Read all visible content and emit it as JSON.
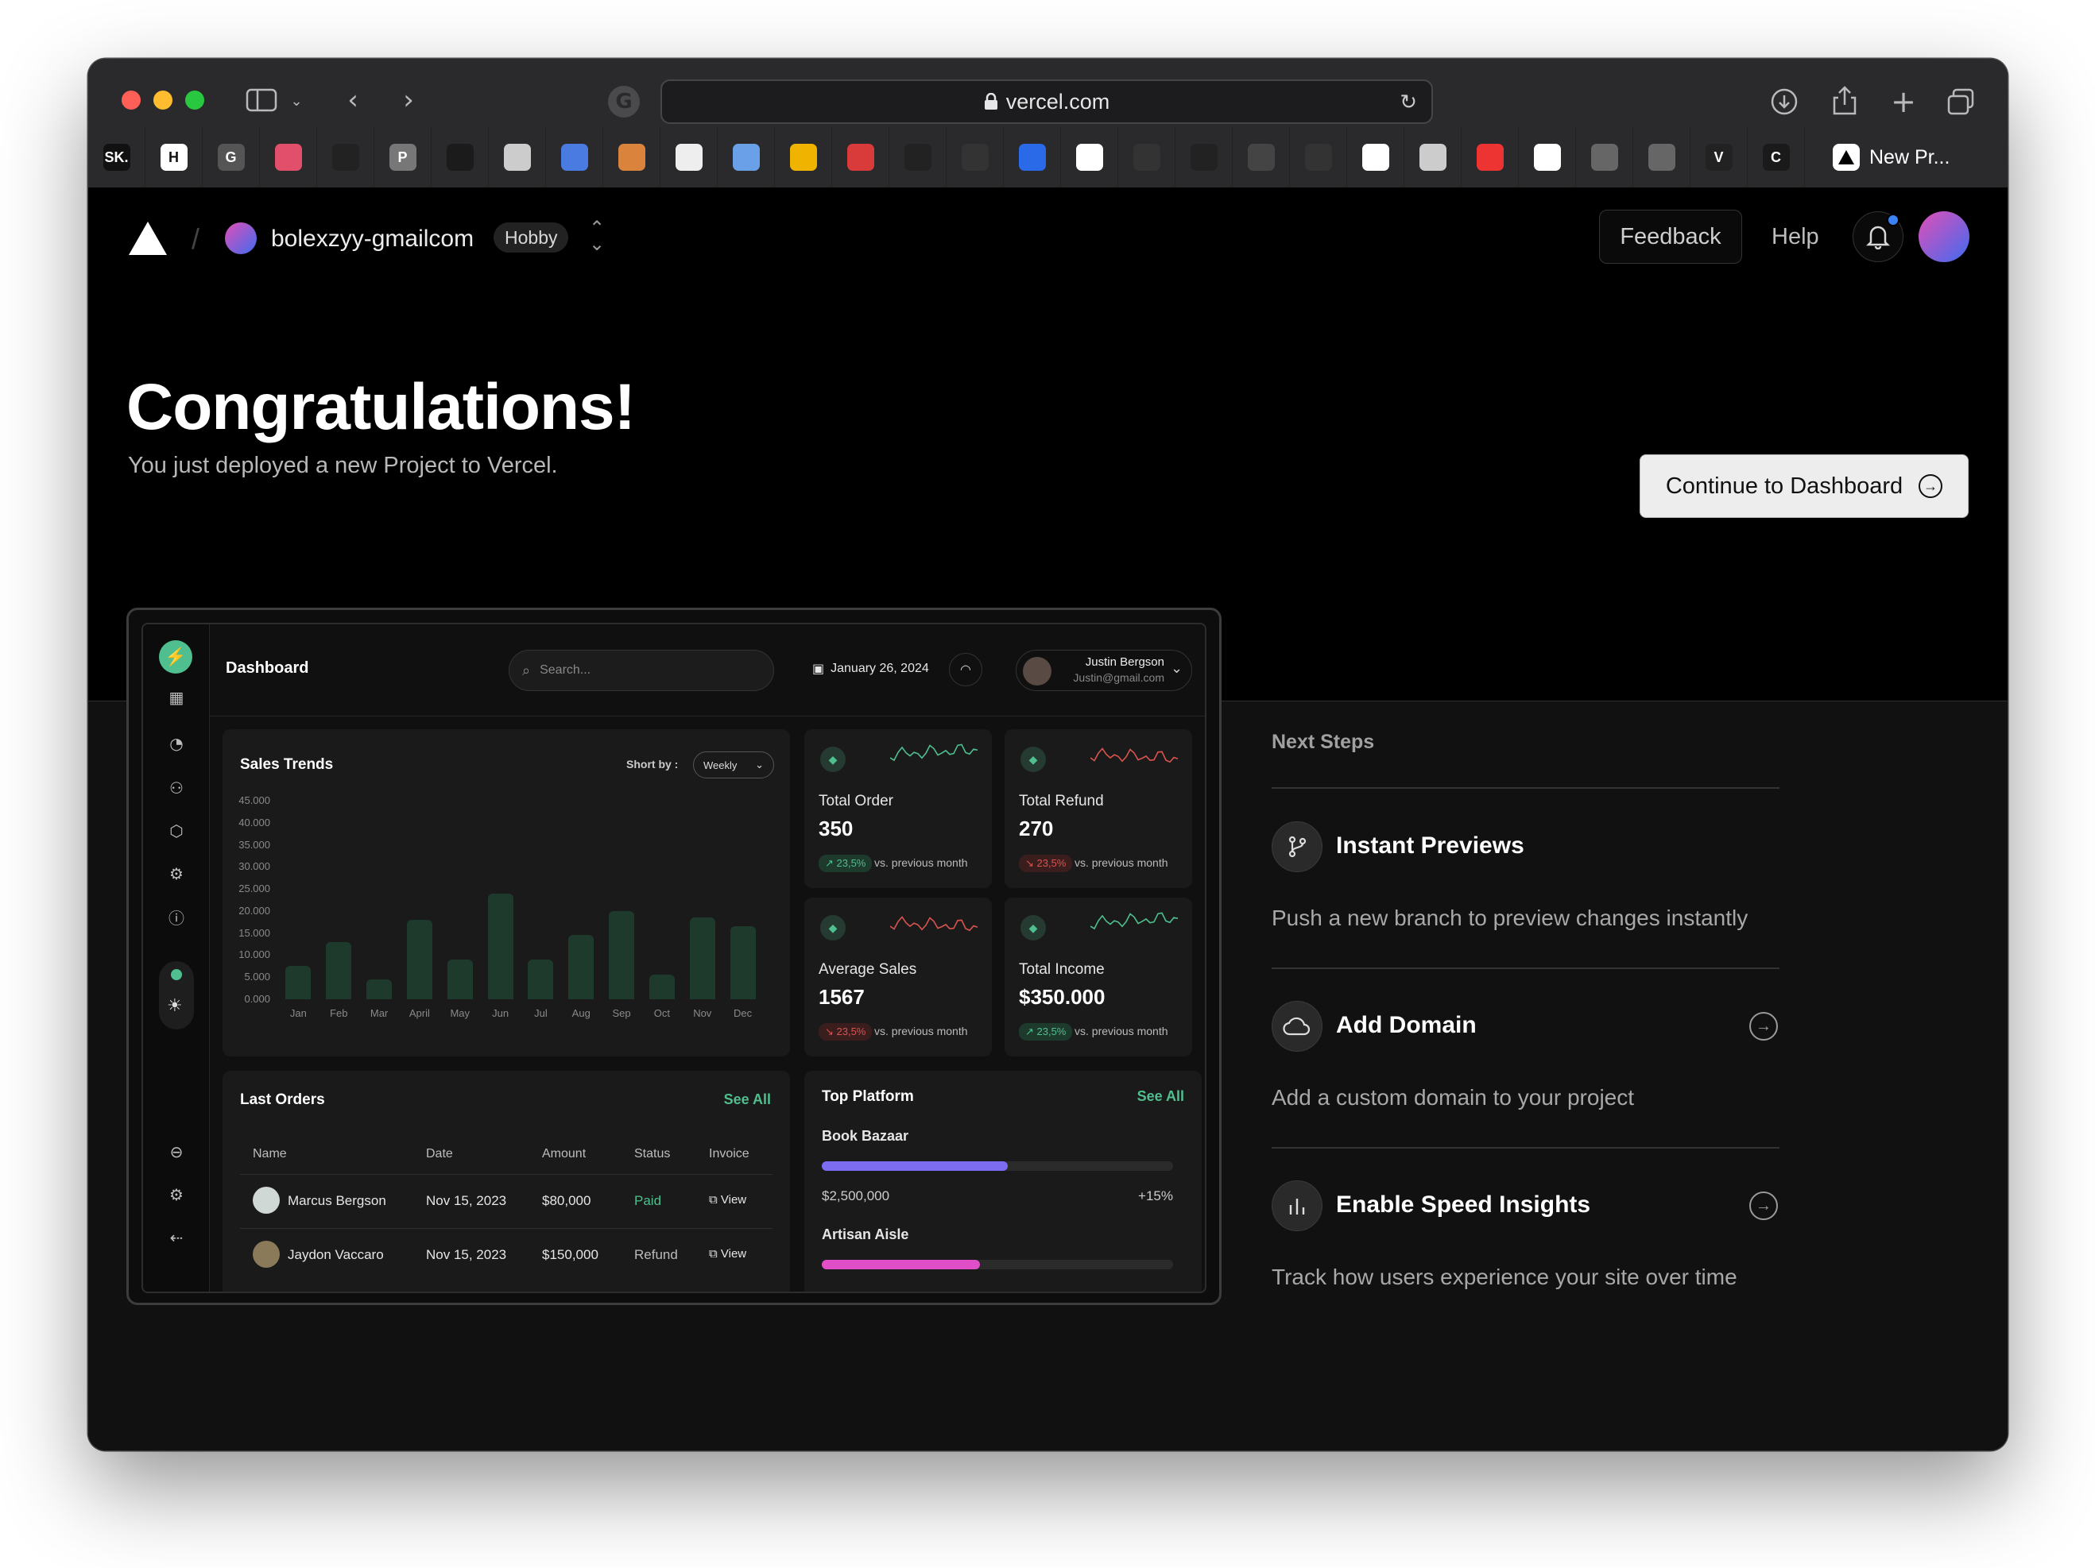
{
  "browser": {
    "url": "vercel.com",
    "tab_title": "New Pr...",
    "bookmarks": [
      "SK.",
      "H",
      "G",
      "",
      "",
      "P",
      "",
      "",
      "",
      "",
      "",
      "",
      "",
      "",
      "",
      "",
      "",
      "",
      "",
      "",
      "",
      "",
      "",
      "",
      "",
      "",
      "",
      "",
      "V",
      "C",
      "",
      "",
      ""
    ]
  },
  "header": {
    "account": "bolexzyy-gmailcom",
    "plan": "Hobby",
    "feedback": "Feedback",
    "help": "Help"
  },
  "hero": {
    "title": "Congratulations!",
    "subtitle": "You just deployed a new Project to Vercel.",
    "cta": "Continue to Dashboard"
  },
  "next_steps": {
    "heading": "Next Steps",
    "items": [
      {
        "title": "Instant Previews",
        "desc": "Push a new branch to preview changes instantly",
        "icon": "git-branch-icon"
      },
      {
        "title": "Add Domain",
        "desc": "Add a custom domain to your project",
        "icon": "cloud-icon"
      },
      {
        "title": "Enable Speed Insights",
        "desc": "Track how users experience your site over time",
        "icon": "bar-chart-icon"
      }
    ]
  },
  "preview": {
    "title": "Dashboard",
    "search_placeholder": "Search...",
    "date": "January 26, 2024",
    "user_name": "Justin Bergson",
    "user_email": "Justin@gmail.com",
    "sales": {
      "title": "Sales Trends",
      "sort_label": "Short by :",
      "sort_value": "Weekly"
    },
    "stats": [
      {
        "label": "Total Order",
        "value": "350",
        "change": "↗ 23,5%",
        "note": "vs. previous month",
        "trend": "up"
      },
      {
        "label": "Total Refund",
        "value": "270",
        "change": "↘ 23,5%",
        "note": "vs. previous month",
        "trend": "down"
      },
      {
        "label": "Average Sales",
        "value": "1567",
        "change": "↘ 23,5%",
        "note": "vs. previous month",
        "trend": "down"
      },
      {
        "label": "Total Income",
        "value": "$350.000",
        "change": "↗ 23,5%",
        "note": "vs. previous month",
        "trend": "up"
      }
    ],
    "orders": {
      "title": "Last Orders",
      "see_all": "See All",
      "columns": [
        "Name",
        "Date",
        "Amount",
        "Status",
        "Invoice"
      ],
      "rows": [
        {
          "name": "Marcus Bergson",
          "date": "Nov 15, 2023",
          "amount": "$80,000",
          "status": "Paid",
          "invoice": "View"
        },
        {
          "name": "Jaydon Vaccaro",
          "date": "Nov 15, 2023",
          "amount": "$150,000",
          "status": "Refund",
          "invoice": "View"
        }
      ]
    },
    "platform": {
      "title": "Top Platform",
      "see_all": "See All",
      "items": [
        {
          "name": "Book Bazaar",
          "amount": "$2,500,000",
          "growth": "+15%",
          "progress": 0.53,
          "color": "#7c6cf0"
        },
        {
          "name": "Artisan Aisle",
          "progress": 0.45,
          "color": "#e04fc7"
        }
      ]
    }
  },
  "chart_data": {
    "type": "bar",
    "title": "Sales Trends",
    "categories": [
      "Jan",
      "Feb",
      "Mar",
      "April",
      "May",
      "Jun",
      "Jul",
      "Aug",
      "Sep",
      "Oct",
      "Nov",
      "Dec"
    ],
    "values": [
      7500,
      13000,
      4500,
      18000,
      9000,
      24000,
      9000,
      14500,
      20000,
      5500,
      18500,
      16500
    ],
    "yticks": [
      "45.000",
      "40.000",
      "35.000",
      "30.000",
      "25.000",
      "20.000",
      "15.000",
      "10.000",
      "5.000",
      "0.000"
    ],
    "ylim": [
      0,
      45000
    ]
  }
}
